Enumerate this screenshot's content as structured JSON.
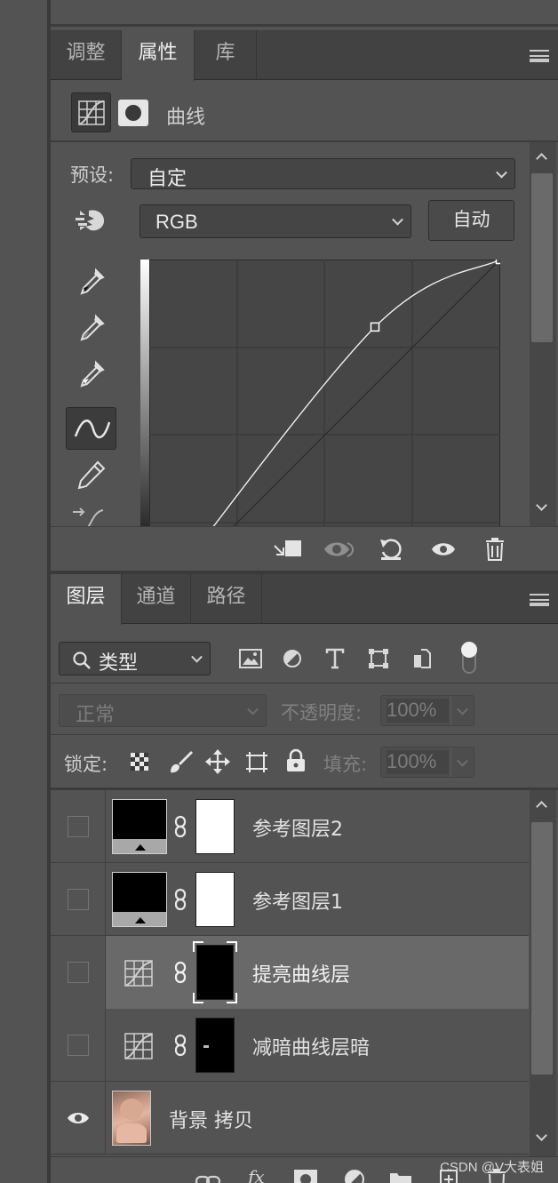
{
  "adjust_panel": {
    "tabs": [
      {
        "label": "调整"
      },
      {
        "label": "属性"
      },
      {
        "label": "库"
      }
    ],
    "active_tab": "属性",
    "type_label": "曲线",
    "preset_label": "预设:",
    "preset_value": "自定",
    "channel_value": "RGB",
    "auto_button": "自动",
    "tools": [
      "sample-black-eyedropper",
      "sample-gray-eyedropper",
      "sample-white-eyedropper",
      "curve-point-tool",
      "pencil-tool",
      "smooth-curve-tool"
    ],
    "footer_icons": [
      "clip-to-layer-icon",
      "view-previous-state-icon",
      "reset-icon",
      "visibility-eye-icon",
      "trash-icon"
    ]
  },
  "curve": {
    "input_range": [
      0,
      255
    ],
    "points": [
      [
        0,
        0
      ],
      [
        164,
        206
      ],
      [
        255,
        255
      ]
    ]
  },
  "layers_panel": {
    "tabs": [
      {
        "label": "图层"
      },
      {
        "label": "通道"
      },
      {
        "label": "路径"
      }
    ],
    "active_tab": "图层",
    "filter_label": "类型",
    "blend_mode": "正常",
    "opacity_label": "不透明度:",
    "opacity_value": "100%",
    "lock_label": "锁定:",
    "fill_label": "填充:",
    "fill_value": "100%",
    "layers": [
      {
        "name": "参考图层2",
        "visible": false,
        "kind": "threshold-adjustment",
        "selected": false
      },
      {
        "name": "参考图层1",
        "visible": false,
        "kind": "threshold-adjustment",
        "selected": false
      },
      {
        "name": "提亮曲线层",
        "visible": false,
        "kind": "curves-adjustment",
        "selected": true
      },
      {
        "name": "减暗曲线层暗",
        "visible": false,
        "kind": "curves-adjustment",
        "selected": false
      },
      {
        "name": "背景 拷贝",
        "visible": true,
        "kind": "pixel",
        "selected": false
      }
    ]
  },
  "watermark": "CSDN @V大表姐"
}
